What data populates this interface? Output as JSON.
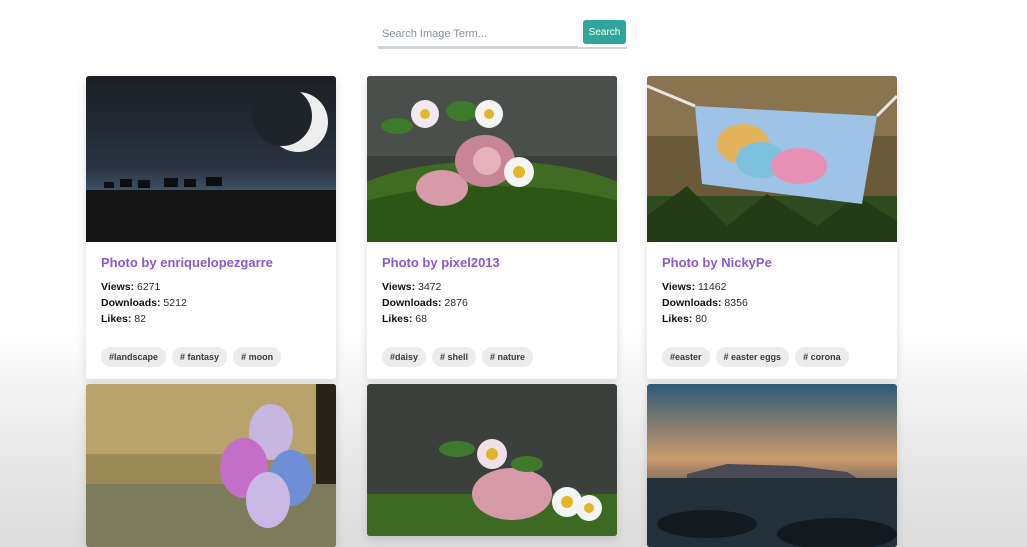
{
  "search": {
    "placeholder": "Search Image Term...",
    "button_label": "Search"
  },
  "cards": [
    {
      "title": "Photo by enriquelopezgarre",
      "views_label": "Views:",
      "views": "6271",
      "downloads_label": "Downloads:",
      "downloads": "5212",
      "likes_label": "Likes:",
      "likes": "82",
      "tags": [
        "#landscape",
        "# fantasy",
        "# moon"
      ]
    },
    {
      "title": "Photo by pixel2013",
      "views_label": "Views:",
      "views": "3472",
      "downloads_label": "Downloads:",
      "downloads": "2876",
      "likes_label": "Likes:",
      "likes": "68",
      "tags": [
        "#daisy",
        "# shell",
        "# nature"
      ]
    },
    {
      "title": "Photo by NickyPe",
      "views_label": "Views:",
      "views": "11462",
      "downloads_label": "Downloads:",
      "downloads": "8356",
      "likes_label": "Likes:",
      "likes": "80",
      "tags": [
        "#easter",
        "# easter eggs",
        "# corona"
      ]
    }
  ],
  "colors": {
    "accent": "#2fa699",
    "title": "#8a5ad0",
    "tag_bg": "#ececec"
  }
}
